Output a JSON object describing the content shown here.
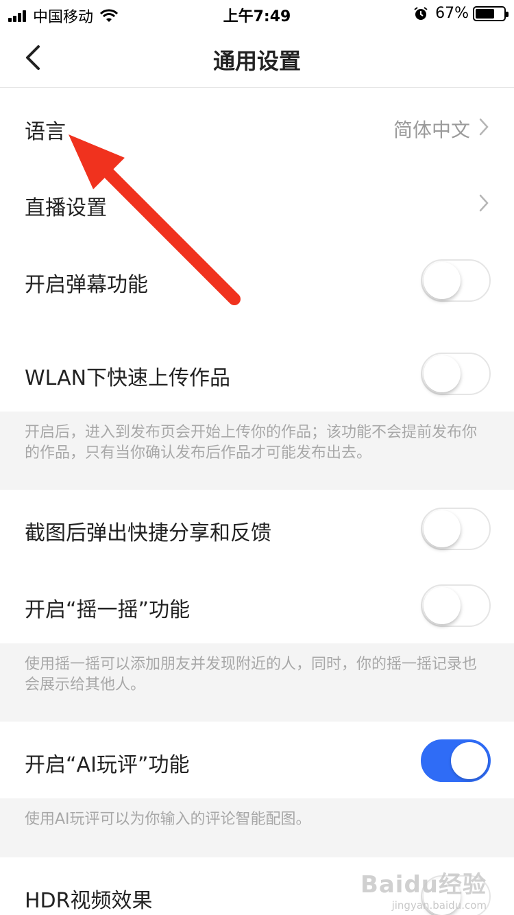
{
  "status_bar": {
    "carrier": "中国移动",
    "time": "上午7:49",
    "battery_percent": "67%",
    "battery_level": 0.67
  },
  "nav": {
    "title": "通用设置"
  },
  "rows": {
    "language": {
      "label": "语言",
      "value": "简体中文"
    },
    "live_settings": {
      "label": "直播设置"
    },
    "danmaku": {
      "label": "开启弹幕功能",
      "on": false
    },
    "wlan_upload": {
      "label": "WLAN下快速上传作品",
      "on": false
    },
    "screenshot_share": {
      "label": "截图后弹出快捷分享和反馈",
      "on": false
    },
    "shake": {
      "label": "开启“摇一摇”功能",
      "on": false
    },
    "ai_comment": {
      "label": "开启“AI玩评”功能",
      "on": true
    },
    "hdr": {
      "label": "HDR视频效果",
      "on": false
    }
  },
  "notes": {
    "wlan_upload_note": "开启后，进入到发布页会开始上传你的作品；该功能不会提前发布你的作品，只有当你确认发布后作品才可能发布出去。",
    "shake_note": "使用摇一摇可以添加朋友并发现附近的人，同时，你的摇一摇记录也会展示给其他人。",
    "ai_comment_note": "使用AI玩评可以为你输入的评论智能配图。"
  },
  "colors": {
    "toggle_on": "#2f6cf6",
    "arrow": "#f0321e"
  },
  "watermark": {
    "main": "Baidu经验",
    "sub": "jingyan.baidu.com"
  }
}
